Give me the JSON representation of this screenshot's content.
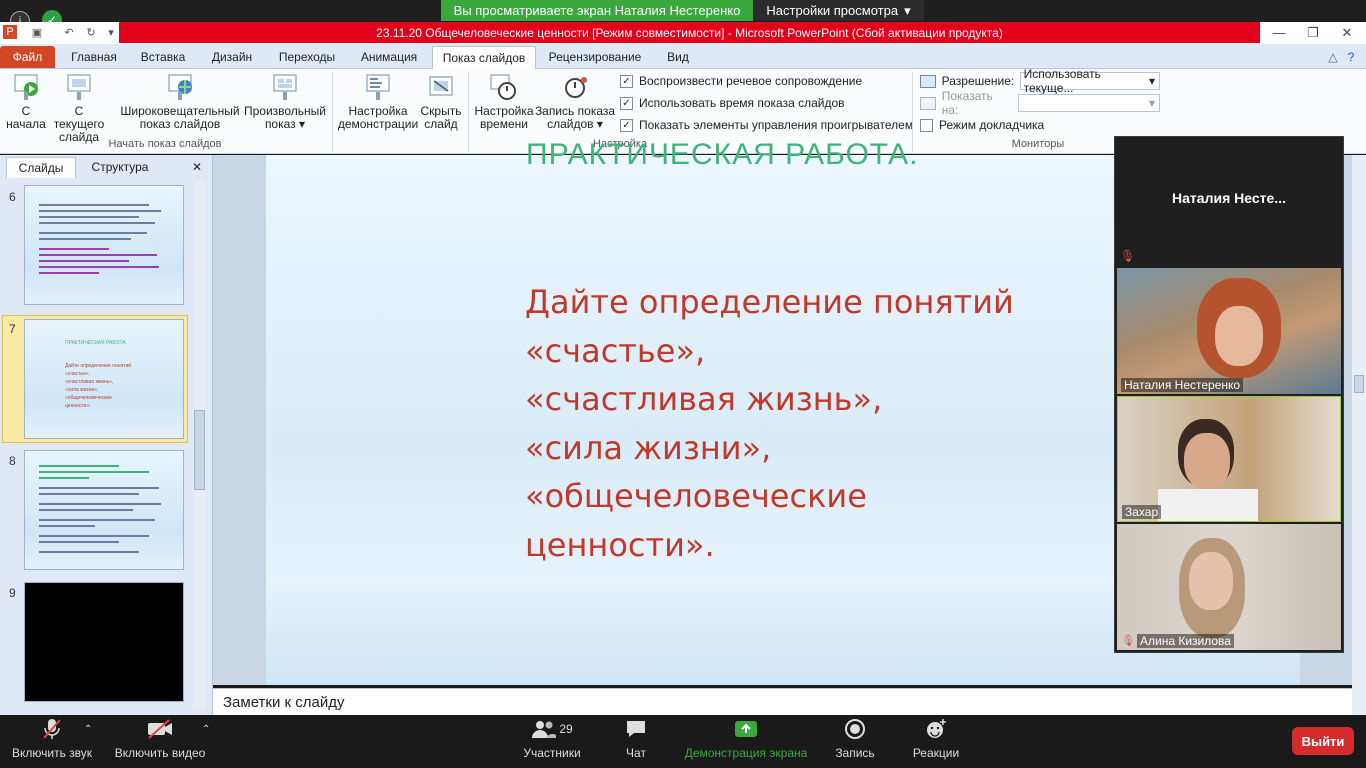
{
  "zoom_top": {
    "share_banner": "Вы просматриваете экран Наталия Нестеренко",
    "view_options": "Настройки просмотра",
    "view_options_arrow": "▾"
  },
  "ppt": {
    "title": "23.11.20 Общечеловеческие ценности [Режим совместимости]  -  Microsoft PowerPoint (Сбой активации продукта)",
    "tabs": [
      "Файл",
      "Главная",
      "Вставка",
      "Дизайн",
      "Переходы",
      "Анимация",
      "Показ слайдов",
      "Рецензирование",
      "Вид"
    ],
    "ribbon": {
      "from_start": "С\nначала",
      "from_current": "С текущего\nслайда",
      "broadcast": "Широковещательный\nпоказ слайдов",
      "custom": "Произвольный\nпоказ ▾",
      "group_start": "Начать показ слайдов",
      "setup": "Настройка\nдемонстрации",
      "hide": "Скрыть\nслайд",
      "rehearse": "Настройка\nвремени",
      "record": "Запись показа\nслайдов ▾",
      "chk_narration": "Воспроизвести речевое сопровождение",
      "chk_timings": "Использовать время показа слайдов",
      "chk_media": "Показать элементы управления проигрывателем",
      "group_setup": "Настройка",
      "resolution_label": "Разрешение:",
      "resolution_value": "Использовать текуще...",
      "show_on_label": "Показать на:",
      "presenter_view": "Режим докладчика",
      "group_monitors": "Мониторы"
    },
    "pane_tabs": [
      "Слайды",
      "Структура"
    ],
    "slide_numbers": [
      "6",
      "7",
      "8",
      "9"
    ],
    "thumb7_title": "ПРАКТИЧЕСКАЯ РАБОТА",
    "thumb7_body": "Дайте определение понятий\n«счастье»,\n«счастливая жизнь»,\n«сила жизни»,\n«общечеловеческие\nценности».",
    "slide_heading": "ПРАКТИЧЕСКАЯ РАБОТА.",
    "slide_body": "Дайте определение понятий\n«счастье»,\n«счастливая жизнь»,\n «сила жизни»,\n«общечеловеческие\nценности».",
    "notes_placeholder": "Заметки к слайду"
  },
  "zoom_panel": {
    "host_name": "Наталия  Несте...",
    "participants": [
      {
        "name": "Наталия Нестеренко",
        "muted": false
      },
      {
        "name": "Захар",
        "muted": false
      },
      {
        "name": "Алина Кизилова",
        "muted": true
      }
    ]
  },
  "zoom_bottom": {
    "audio": "Включить звук",
    "video": "Включить видео",
    "participants": "Участники",
    "participants_count": "29",
    "chat": "Чат",
    "share": "Демонстрация экрана",
    "record": "Запись",
    "reactions": "Реакции",
    "leave": "Выйти"
  },
  "colors": {
    "ppt_title_red": "#e3001b",
    "share_green": "#3aa83c",
    "slide_text_red": "#c0392b",
    "slide_heading_green": "#3fb37a",
    "leave_red": "#d42c2c"
  }
}
